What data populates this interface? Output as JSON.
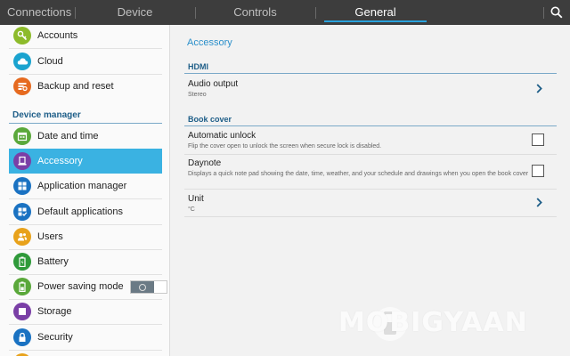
{
  "tabs": [
    {
      "label": "Connections",
      "active": false
    },
    {
      "label": "Device",
      "active": false
    },
    {
      "label": "Controls",
      "active": false
    },
    {
      "label": "General",
      "active": true
    }
  ],
  "sidebar": {
    "items_top": [
      {
        "label": "Accounts",
        "icon": "key-icon",
        "color": "#8dbb2b"
      },
      {
        "label": "Cloud",
        "icon": "cloud-icon",
        "color": "#1aa3cf"
      },
      {
        "label": "Backup and reset",
        "icon": "backup-icon",
        "color": "#e66a1f"
      }
    ],
    "section_header": "Device manager",
    "items": [
      {
        "label": "Date and time",
        "icon": "calendar-icon",
        "color": "#5aa83a"
      },
      {
        "label": "Accessory",
        "icon": "accessory-icon",
        "color": "#7a3fa6",
        "active": true
      },
      {
        "label": "Application manager",
        "icon": "apps-icon",
        "color": "#1a72c2"
      },
      {
        "label": "Default applications",
        "icon": "default-apps-icon",
        "color": "#1a72c2"
      },
      {
        "label": "Users",
        "icon": "users-icon",
        "color": "#e8a21b"
      },
      {
        "label": "Battery",
        "icon": "battery-icon",
        "color": "#2f9a3a"
      },
      {
        "label": "Power saving mode",
        "icon": "power-saving-icon",
        "color": "#5aa83a",
        "toggle": "off"
      },
      {
        "label": "Storage",
        "icon": "storage-icon",
        "color": "#7a3fa6"
      },
      {
        "label": "Security",
        "icon": "lock-icon",
        "color": "#1a72c2"
      }
    ]
  },
  "main": {
    "title": "Accessory",
    "sections": [
      {
        "header": "HDMI",
        "rows": [
          {
            "title": "Audio output",
            "subtitle": "Stereo",
            "control": "chevron"
          }
        ]
      },
      {
        "header": "Book cover",
        "rows": [
          {
            "title": "Automatic unlock",
            "subtitle": "Flip the cover open to unlock the screen when secure lock is disabled.",
            "control": "checkbox",
            "checked": false
          },
          {
            "title": "Daynote",
            "subtitle": "Displays a quick note pad showing the date, time, weather, and your schedule and drawings when you open the book cover",
            "control": "checkbox",
            "checked": false
          },
          {
            "title": "Unit",
            "subtitle": "°C",
            "control": "chevron"
          }
        ]
      }
    ]
  },
  "watermark": "MOBIGYAAN",
  "colors": {
    "accent": "#2aa3dd",
    "active_bg": "#3ab2e2",
    "header_blue": "#1e5e88",
    "topbar": "#3d3d3d"
  }
}
